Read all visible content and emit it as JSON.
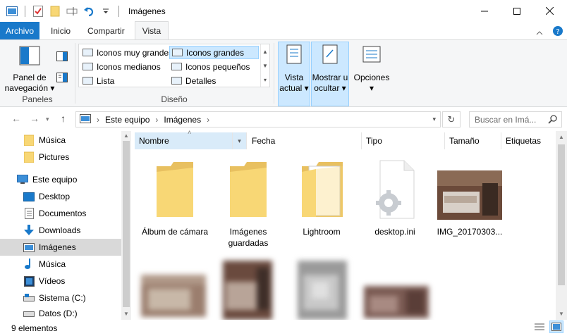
{
  "window": {
    "title": "Imágenes"
  },
  "ribbon_tabs": [
    "Archivo",
    "Inicio",
    "Compartir",
    "Vista"
  ],
  "ribbon": {
    "panel_nav_line1": "Panel de",
    "panel_nav_line2": "navegación",
    "group_panes": "Paneles",
    "group_layout": "Diseño",
    "layouts": {
      "very_large": "Iconos muy grandes",
      "large": "Iconos grandes",
      "medium": "Iconos medianos",
      "small": "Iconos pequeños",
      "list": "Lista",
      "details": "Detalles"
    },
    "current_view_line1": "Vista",
    "current_view_line2": "actual",
    "show_hide_line1": "Mostrar u",
    "show_hide_line2": "ocultar",
    "options": "Opciones"
  },
  "address": {
    "segments": [
      "Este equipo",
      "Imágenes"
    ],
    "search_placeholder": "Buscar en Imá..."
  },
  "nav": {
    "musica_top": "Música",
    "pictures": "Pictures",
    "este_equipo": "Este equipo",
    "desktop": "Desktop",
    "documentos": "Documentos",
    "downloads": "Downloads",
    "imagenes": "Imágenes",
    "musica": "Música",
    "videos": "Vídeos",
    "sistema": "Sistema (C:)",
    "datos": "Datos (D:)"
  },
  "columns": [
    "Nombre",
    "Fecha",
    "Tipo",
    "Tamaño",
    "Etiquetas"
  ],
  "files": {
    "album": "Álbum de cámara",
    "guardadas": "Imágenes guardadas",
    "lightroom": "Lightroom",
    "desktop_ini": "desktop.ini",
    "img": "IMG_20170303..."
  },
  "status": {
    "count": "9 elementos"
  },
  "colors": {
    "accent": "#1979ca",
    "selection": "#cce8ff",
    "folder": "#f8d775"
  }
}
